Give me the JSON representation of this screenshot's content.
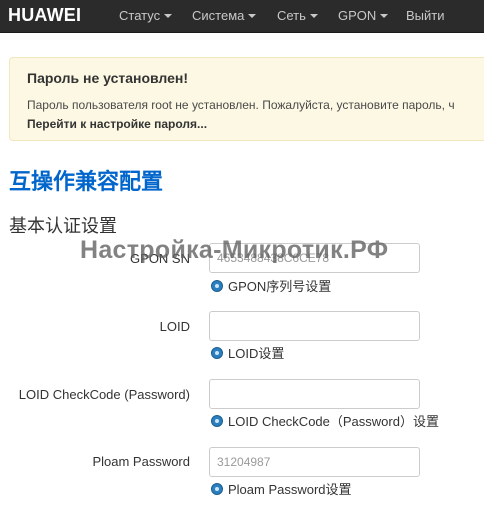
{
  "nav": {
    "brand": "HUAWEI",
    "items": [
      {
        "label": "Статус",
        "dropdown": true
      },
      {
        "label": "Система",
        "dropdown": true
      },
      {
        "label": "Сеть",
        "dropdown": true
      },
      {
        "label": "GPON",
        "dropdown": true
      },
      {
        "label": "Выйти",
        "dropdown": false
      }
    ]
  },
  "alert": {
    "title": "Пароль не установлен!",
    "text": "Пароль пользователя root не установлен. Пожалуйста, установите пароль, ч",
    "link": "Перейти к настройке пароля..."
  },
  "page": {
    "title": "互操作兼容配置",
    "section": "基本认证设置",
    "watermark": "Настройка-Микротик.РФ"
  },
  "form": {
    "gpon_sn": {
      "label": "GPON SN",
      "value": "4653488438C6CE78",
      "hint": "GPON序列号设置"
    },
    "loid": {
      "label": "LOID",
      "value": "",
      "hint": "LOID设置"
    },
    "loid_checkcode": {
      "label": "LOID CheckCode (Password)",
      "value": "",
      "hint": "LOID CheckCode（Password）设置"
    },
    "ploam_password": {
      "label": "Ploam Password",
      "value": "31204987",
      "hint": "Ploam Password设置"
    }
  }
}
